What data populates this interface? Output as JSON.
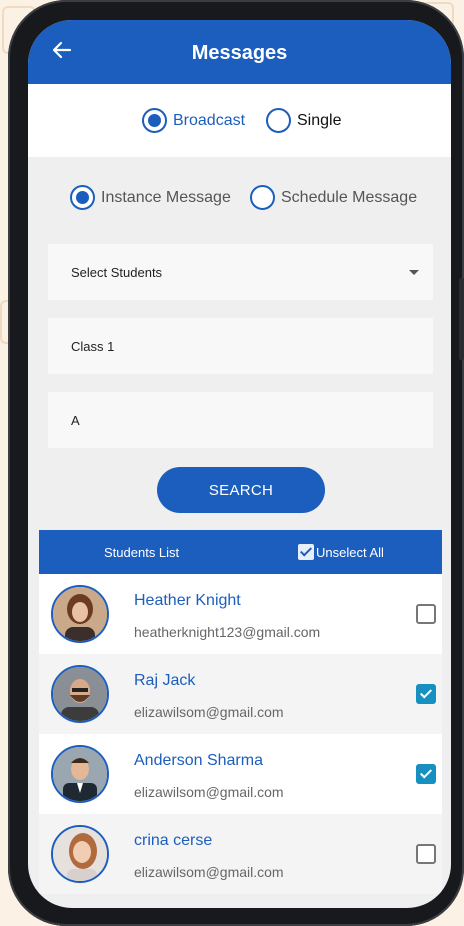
{
  "header": {
    "title": "Messages"
  },
  "mode": {
    "options": [
      {
        "label": "Broadcast",
        "selected": true
      },
      {
        "label": "Single",
        "selected": false
      }
    ]
  },
  "message_type": {
    "options": [
      {
        "label": "Instance Message",
        "selected": true
      },
      {
        "label": "Schedule Message",
        "selected": false
      }
    ]
  },
  "form": {
    "select_students": "Select Students",
    "class_value": "Class 1",
    "section_value": "A",
    "search_label": "SEARCH"
  },
  "students_list": {
    "title": "Students List",
    "unselect_all_label": "Unselect All",
    "students": [
      {
        "name": "Heather Knight",
        "email": "heatherknight123@gmail.com",
        "checked": false
      },
      {
        "name": "Raj Jack",
        "email": "elizawilsom@gmail.com",
        "checked": true
      },
      {
        "name": "Anderson Sharma",
        "email": "elizawilsom@gmail.com",
        "checked": true
      },
      {
        "name": "crina cerse",
        "email": "elizawilsom@gmail.com",
        "checked": false
      }
    ]
  },
  "colors": {
    "primary": "#1c5ebd",
    "check": "#1590c0"
  }
}
